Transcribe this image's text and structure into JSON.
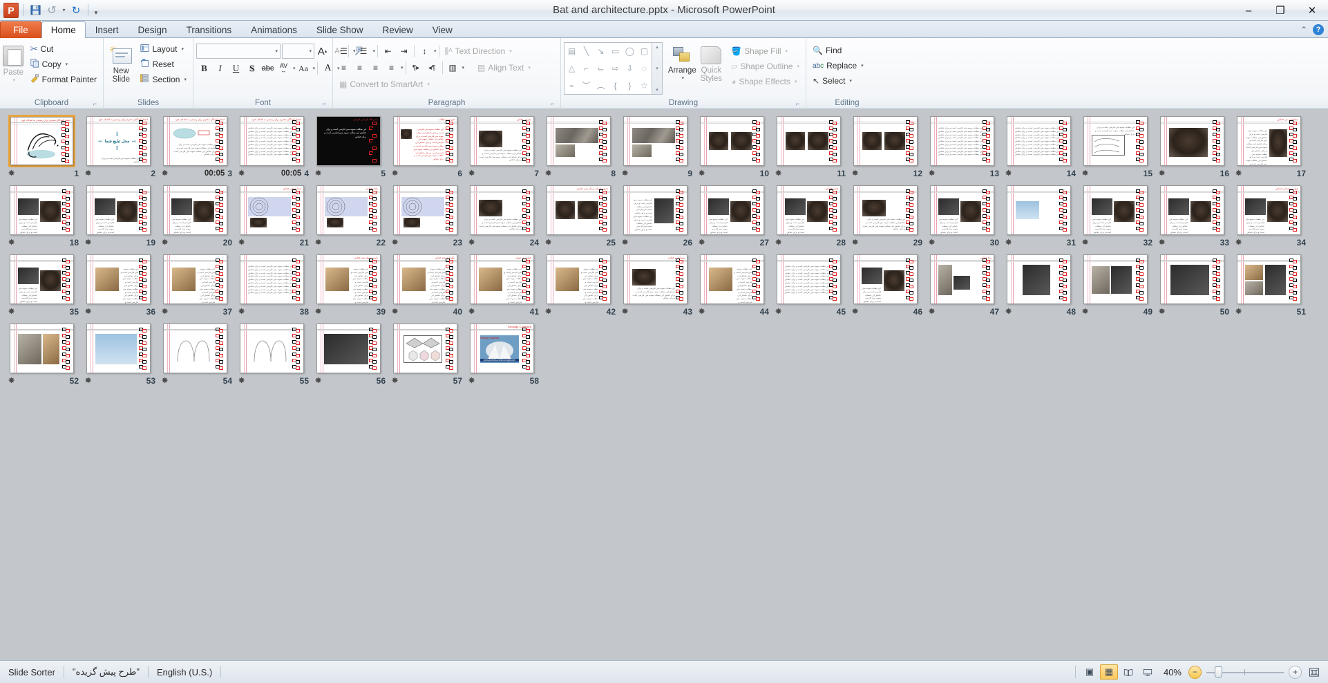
{
  "window": {
    "title": "Bat and architecture.pptx  -  Microsoft PowerPoint",
    "minimize": "–",
    "maximize": "❐",
    "close": "✕"
  },
  "quick_access": {
    "logo": "P",
    "save": "💾",
    "undo": "↺",
    "redo": "↻",
    "customize": "▼"
  },
  "tabs": [
    {
      "label": "File",
      "id": "file"
    },
    {
      "label": "Home",
      "id": "home"
    },
    {
      "label": "Insert",
      "id": "insert"
    },
    {
      "label": "Design",
      "id": "design"
    },
    {
      "label": "Transitions",
      "id": "transitions"
    },
    {
      "label": "Animations",
      "id": "animations"
    },
    {
      "label": "Slide Show",
      "id": "slide-show"
    },
    {
      "label": "Review",
      "id": "review"
    },
    {
      "label": "View",
      "id": "view"
    }
  ],
  "tabstrip_right": {
    "collapse_ribbon": "⌃",
    "help": "?"
  },
  "ribbon": {
    "groups": [
      {
        "label": "Clipboard",
        "has_launcher": true
      },
      {
        "label": "Slides",
        "has_launcher": false
      },
      {
        "label": "Font",
        "has_launcher": true
      },
      {
        "label": "Paragraph",
        "has_launcher": true
      },
      {
        "label": "Drawing",
        "has_launcher": true
      },
      {
        "label": "Editing",
        "has_launcher": false
      }
    ],
    "clipboard": {
      "paste": "Paste",
      "cut": "Cut",
      "copy": "Copy",
      "format_painter": "Format Painter"
    },
    "slides": {
      "new_slide": "New\nSlide",
      "new_slide_line1": "New",
      "new_slide_line2": "Slide",
      "layout": "Layout",
      "reset": "Reset",
      "section": "Section"
    },
    "font": {
      "font_name_value": "",
      "font_size_value": "",
      "grow_font": "A",
      "shrink_font": "A",
      "clear_formatting": "Aa",
      "bold": "B",
      "italic": "I",
      "underline": "U",
      "shadow": "S",
      "strikethrough": "abc",
      "character_spacing": "AV",
      "change_case": "Aa",
      "font_color": "A"
    },
    "paragraph": {
      "bullets": "☰",
      "numbering": "☰",
      "decrease_indent": "⇤",
      "increase_indent": "⇥",
      "line_spacing": "↕",
      "align_left": "≡",
      "center": "≡",
      "align_right": "≡",
      "justify": "≡",
      "ltr": "¶▸",
      "rtl": "◂¶",
      "columns": "▥",
      "text_direction": "Text Direction",
      "align_text": "Align Text",
      "convert_to_smartart": "Convert to SmartArt"
    },
    "drawing": {
      "arrange": "Arrange",
      "quick_styles_line1": "Quick",
      "quick_styles_line2": "Styles",
      "shape_fill": "Shape Fill",
      "shape_outline": "Shape Outline",
      "shape_effects": "Shape Effects",
      "shapes": [
        "▤",
        "╲",
        "↘",
        "▭",
        "◯",
        "▢",
        "△",
        "⌐",
        "⌙",
        "⇨",
        "⇩",
        "◌",
        "⌁",
        "︶",
        "︵",
        "{",
        "}",
        "☆"
      ]
    },
    "editing": {
      "find": "Find",
      "replace": "Replace",
      "select": "Select"
    }
  },
  "status_bar": {
    "view_name": "Slide Sorter",
    "theme_name": "\"طرح پیش گزیده\"",
    "language": "English (U.S.)",
    "zoom_level": "40%",
    "zoom_out": "−",
    "zoom_in": "+",
    "view_buttons": [
      {
        "name": "normal",
        "glyph": "▣",
        "active": false
      },
      {
        "name": "slide-sorter",
        "glyph": "▦",
        "active": true
      },
      {
        "name": "reading-view",
        "glyph": "📖",
        "active": false
      },
      {
        "name": "slide-show",
        "glyph": "🖵",
        "active": false
      }
    ],
    "fit_to_window": "⛶"
  },
  "sorter": {
    "selected_slide": 1,
    "total_slides": 58,
    "transition_icon": "✸",
    "slides": [
      {
        "n": 1,
        "timing": "",
        "kind": "title-calligraphy",
        "title": "انتشارکنندگان محترم برای رسیدن به اهداف خود",
        "selected": true
      },
      {
        "n": 2,
        "timing": "",
        "kind": "ad-placeholder",
        "title": "انتشارکنندگان محترم برای رسیدن به اهداف خود",
        "center_text": "محل تبلیغ شما"
      },
      {
        "n": 3,
        "timing": "00:05",
        "kind": "cloud-diagram",
        "title": "انتشارکنندگان محترم برای رسیدن به اهداف خود"
      },
      {
        "n": 4,
        "timing": "00:05",
        "kind": "text-dense",
        "title": "انتشارکنندگان محترم برای رسیدن به اهداف خود"
      },
      {
        "n": 5,
        "timing": "",
        "kind": "black-slide",
        "title": "بسم الله الرحمن الرحیم"
      },
      {
        "n": 6,
        "timing": "",
        "kind": "toc-list",
        "title": "فهرست مطالب"
      },
      {
        "n": 7,
        "timing": "",
        "kind": "photo-left-text-right",
        "title": "معرفی خفاش"
      },
      {
        "n": 8,
        "timing": "",
        "kind": "photo-wide",
        "title": ""
      },
      {
        "n": 9,
        "timing": "",
        "kind": "photo-wide",
        "title": ""
      },
      {
        "n": 10,
        "timing": "",
        "kind": "bat-pair",
        "title": ""
      },
      {
        "n": 11,
        "timing": "",
        "kind": "bat-pair",
        "title": ""
      },
      {
        "n": 12,
        "timing": "",
        "kind": "bat-pair",
        "title": ""
      },
      {
        "n": 13,
        "timing": "",
        "kind": "text-dense",
        "title": ""
      },
      {
        "n": 14,
        "timing": "",
        "kind": "text-dense",
        "title": ""
      },
      {
        "n": 15,
        "timing": "",
        "kind": "diagram-lines",
        "title": ""
      },
      {
        "n": 16,
        "timing": "",
        "kind": "anatomy-bat",
        "title": ""
      },
      {
        "n": 17,
        "timing": "",
        "kind": "photo-right-text-left",
        "title": "ساختمان بدن خفاش"
      },
      {
        "n": 18,
        "timing": "",
        "kind": "photo-dark-pair",
        "title": ""
      },
      {
        "n": 19,
        "timing": "",
        "kind": "photo-dark-pair",
        "title": ""
      },
      {
        "n": 20,
        "timing": "",
        "kind": "photo-dark-pair",
        "title": ""
      },
      {
        "n": 21,
        "timing": "",
        "kind": "echo-diagram",
        "title": "صدا سنجی خفاش"
      },
      {
        "n": 22,
        "timing": "",
        "kind": "echo-diagram",
        "title": "رادار خفاش"
      },
      {
        "n": 23,
        "timing": "",
        "kind": "echo-diagram",
        "title": ""
      },
      {
        "n": 24,
        "timing": "",
        "kind": "photo-left-text-right",
        "title": ""
      },
      {
        "n": 25,
        "timing": "",
        "kind": "bat-pair",
        "title": "تصویر حرکت و بال زدن خفاش"
      },
      {
        "n": 26,
        "timing": "",
        "kind": "bat-fly-white",
        "title": ""
      },
      {
        "n": 27,
        "timing": "",
        "kind": "photo-dark-pair",
        "title": ""
      },
      {
        "n": 28,
        "timing": "",
        "kind": "photo-dark-pair",
        "title": "تغذیه خفاش"
      },
      {
        "n": 29,
        "timing": "",
        "kind": "photo-left-text-right",
        "title": ""
      },
      {
        "n": 30,
        "timing": "",
        "kind": "photo-dark-pair",
        "title": ""
      },
      {
        "n": 31,
        "timing": "",
        "kind": "sky-birds",
        "title": ""
      },
      {
        "n": 32,
        "timing": "",
        "kind": "photo-dark-pair",
        "title": ""
      },
      {
        "n": 33,
        "timing": "",
        "kind": "photo-dark-pair",
        "title": ""
      },
      {
        "n": 34,
        "timing": "",
        "kind": "photo-dark-pair",
        "title": "خواب زمستانی خفاش"
      },
      {
        "n": 35,
        "timing": "",
        "kind": "photo-dark-pair",
        "title": ""
      },
      {
        "n": 36,
        "timing": "",
        "kind": "photo-warm",
        "title": ""
      },
      {
        "n": 37,
        "timing": "",
        "kind": "photo-warm",
        "title": ""
      },
      {
        "n": 38,
        "timing": "",
        "kind": "text-dense",
        "title": ""
      },
      {
        "n": 39,
        "timing": "",
        "kind": "photo-warm",
        "title": "زایش و تولد بچه خفاش"
      },
      {
        "n": 40,
        "timing": "",
        "kind": "photo-warm",
        "title": "نگهداری بچه خفاش"
      },
      {
        "n": 41,
        "timing": "",
        "kind": "photo-warm",
        "title": "خفاش در خواب"
      },
      {
        "n": 42,
        "timing": "",
        "kind": "photo-warm",
        "title": ""
      },
      {
        "n": 43,
        "timing": "",
        "kind": "photo-left-text-right",
        "title": "معماری و خفاش"
      },
      {
        "n": 44,
        "timing": "",
        "kind": "photo-warm",
        "title": ""
      },
      {
        "n": 45,
        "timing": "",
        "kind": "text-dense",
        "title": ""
      },
      {
        "n": 46,
        "timing": "",
        "kind": "photo-dark-pair",
        "title": ""
      },
      {
        "n": 47,
        "timing": "",
        "kind": "tower-photo",
        "title": "برج خفاش"
      },
      {
        "n": 48,
        "timing": "",
        "kind": "chandelier",
        "title": ""
      },
      {
        "n": 49,
        "timing": "",
        "kind": "lamp-pair",
        "title": ""
      },
      {
        "n": 50,
        "timing": "",
        "kind": "sculpture",
        "title": ""
      },
      {
        "n": 51,
        "timing": "",
        "kind": "ornament",
        "title": ""
      },
      {
        "n": 52,
        "timing": "",
        "kind": "architecture-col",
        "title": ""
      },
      {
        "n": 53,
        "timing": "",
        "kind": "tower-green",
        "title": ""
      },
      {
        "n": 54,
        "timing": "",
        "kind": "line-drawings",
        "title": ""
      },
      {
        "n": 55,
        "timing": "",
        "kind": "line-drawings",
        "title": ""
      },
      {
        "n": 56,
        "timing": "",
        "kind": "interior-dark",
        "title": ""
      },
      {
        "n": 57,
        "timing": "",
        "kind": "bat-house-plan",
        "title": ""
      },
      {
        "n": 58,
        "timing": "",
        "kind": "calatrava",
        "title": "Santiago Calatrava",
        "footer": "www.amirreza-rahimi.blogfa.com"
      }
    ]
  }
}
